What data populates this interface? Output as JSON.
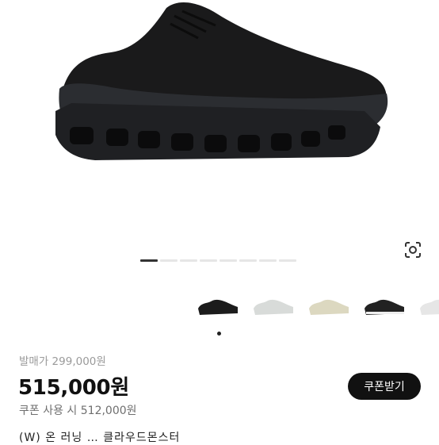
{
  "product": {
    "image_alt": "black running shoe",
    "thumbnails": [
      {
        "name": "black-shoe",
        "color": "#1c1c1c"
      },
      {
        "name": "white-shoe",
        "color": "#d8dbd9"
      },
      {
        "name": "cream-shoe",
        "color": "#dcd8c0"
      },
      {
        "name": "black-white-shoe",
        "color": "#222222"
      },
      {
        "name": "white-shoe-2",
        "color": "#e6e6e6"
      }
    ],
    "pager": {
      "count": 8,
      "active": 0
    }
  },
  "pricing": {
    "original_price": "발매가 299,000원",
    "price": "515,000원",
    "coupon_price": "쿠폰 사용 시 512,000원",
    "coupon_button": "쿠폰받기"
  },
  "title": "(W) 온 러닝 … 클라우드몬스터"
}
